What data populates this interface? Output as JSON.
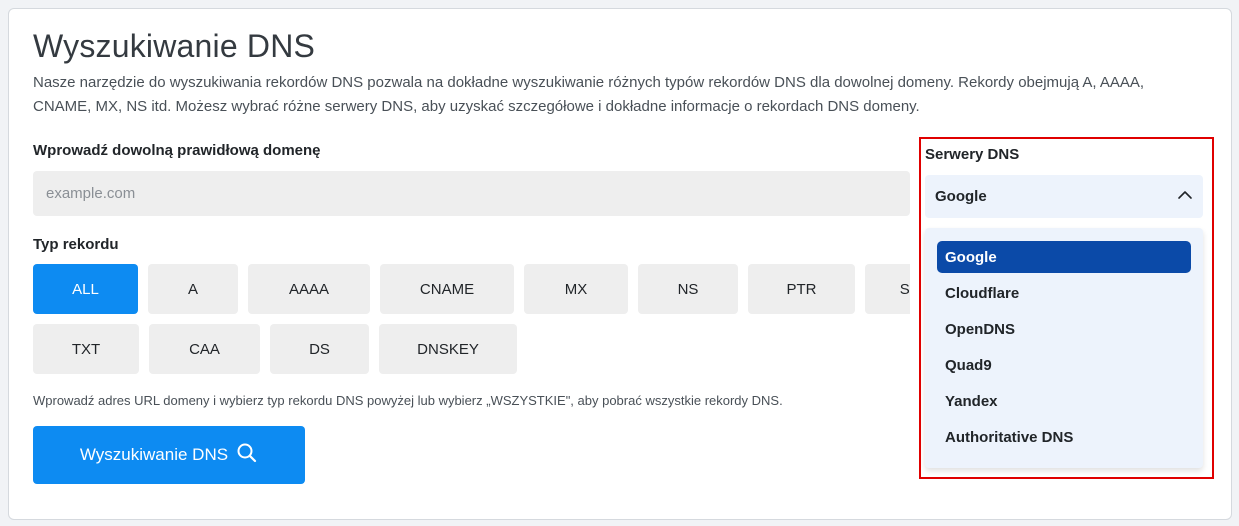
{
  "page": {
    "title": "Wyszukiwanie DNS",
    "description": "Nasze narzędzie do wyszukiwania rekordów DNS pozwala na dokładne wyszukiwanie różnych typów rekordów DNS dla dowolnej domeny. Rekordy obejmują A, AAAA, CNAME, MX, NS itd. Możesz wybrać różne serwery DNS, aby uzyskać szczegółowe i dokładne informacje o rekordach DNS domeny."
  },
  "domain": {
    "label": "Wprowadź dowolną prawidłową domenę",
    "value": "",
    "placeholder": "example.com"
  },
  "record_type": {
    "label": "Typ rekordu",
    "row1": [
      "ALL",
      "A",
      "AAAA",
      "CNAME",
      "MX",
      "NS",
      "PTR",
      "SRV"
    ],
    "row2": [
      "TXT",
      "CAA",
      "DS",
      "DNSKEY"
    ],
    "active": "ALL"
  },
  "hint": "Wprowadź adres URL domeny i wybierz typ rekordu DNS powyżej lub wybierz „WSZYSTKIE\", aby pobrać wszystkie rekordy DNS.",
  "lookup_button": {
    "label": "Wyszukiwanie DNS",
    "icon": "search-icon"
  },
  "dns_servers": {
    "label": "Serwery DNS",
    "selected": "Google",
    "options": [
      "Google",
      "Cloudflare",
      "OpenDNS",
      "Quad9",
      "Yandex",
      "Authoritative DNS"
    ],
    "icon": "chevron-up-icon"
  },
  "colors": {
    "primary": "#0d8bf2",
    "selected_option": "#0b4aa8",
    "highlight_border": "#e00000"
  }
}
